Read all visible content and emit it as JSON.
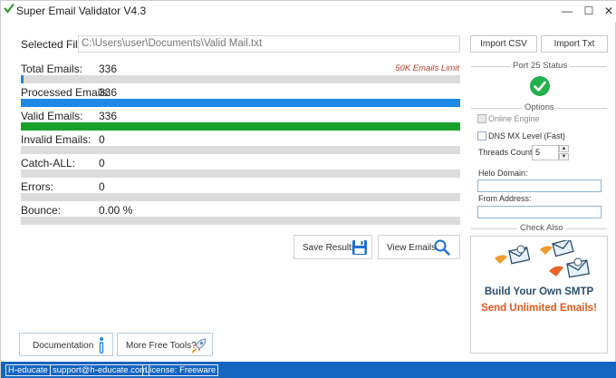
{
  "window": {
    "title": "Super Email Validator V4.3",
    "controls": {
      "minimize": "—",
      "maximize": "☐",
      "close": "✕"
    }
  },
  "file": {
    "label": "Selected File:",
    "path": "C:\\Users\\user\\Documents\\Valid Mail.txt"
  },
  "limit_note": "50K Emails Limit",
  "stats": [
    {
      "label": "Total Emails:",
      "value": "336",
      "progress": 0.004,
      "color": "#1e88e5"
    },
    {
      "label": "Processed Emails:",
      "value": "336",
      "progress": 1.0,
      "color": "#1e88e5"
    },
    {
      "label": "Valid Emails:",
      "value": "336",
      "progress": 1.0,
      "color": "#16a22a"
    },
    {
      "label": "Invalid Emails:",
      "value": "0",
      "progress": 0,
      "color": "#1e88e5"
    },
    {
      "label": "Catch-ALL:",
      "value": "0",
      "progress": 0,
      "color": "#1e88e5"
    },
    {
      "label": "Errors:",
      "value": "0",
      "progress": 0,
      "color": "#1e88e5"
    },
    {
      "label": "Bounce:",
      "value": "0.00 %",
      "progress": 0,
      "color": "#1e88e5"
    }
  ],
  "actions": {
    "save_results": {
      "label": "Save Results",
      "icon": "floppy-disk-icon"
    },
    "view_emails": {
      "label": "View Emails",
      "icon": "magnifier-icon"
    }
  },
  "bottom_buttons": {
    "documentation": {
      "label": "Documentation",
      "icon": "info-icon"
    },
    "more_tools": {
      "label": "More Free Tools?",
      "icon": "rocket-icon"
    }
  },
  "import": {
    "csv": "Import CSV",
    "txt": "Import Txt"
  },
  "port_status": {
    "title": "Port  25 Status",
    "icon": "green-checkmark-icon",
    "color": "#22b14c"
  },
  "options": {
    "title": "Options",
    "online_engine": "Online Engine",
    "dns_mx": "DNS MX Level (Fast)",
    "threads_label": "Threads Count:",
    "threads_value": "5",
    "helo_label": "Helo Domain:",
    "from_label": "From Address:"
  },
  "check_also": {
    "title": "Check Also",
    "ad_title": "Build Your Own SMTP",
    "ad_subtitle": "Send Unlimited Emails!"
  },
  "statusbar": {
    "company": "H-educate",
    "email": "support@h-educate.com",
    "license": "License: Freeware",
    "color": "#1565c0"
  }
}
